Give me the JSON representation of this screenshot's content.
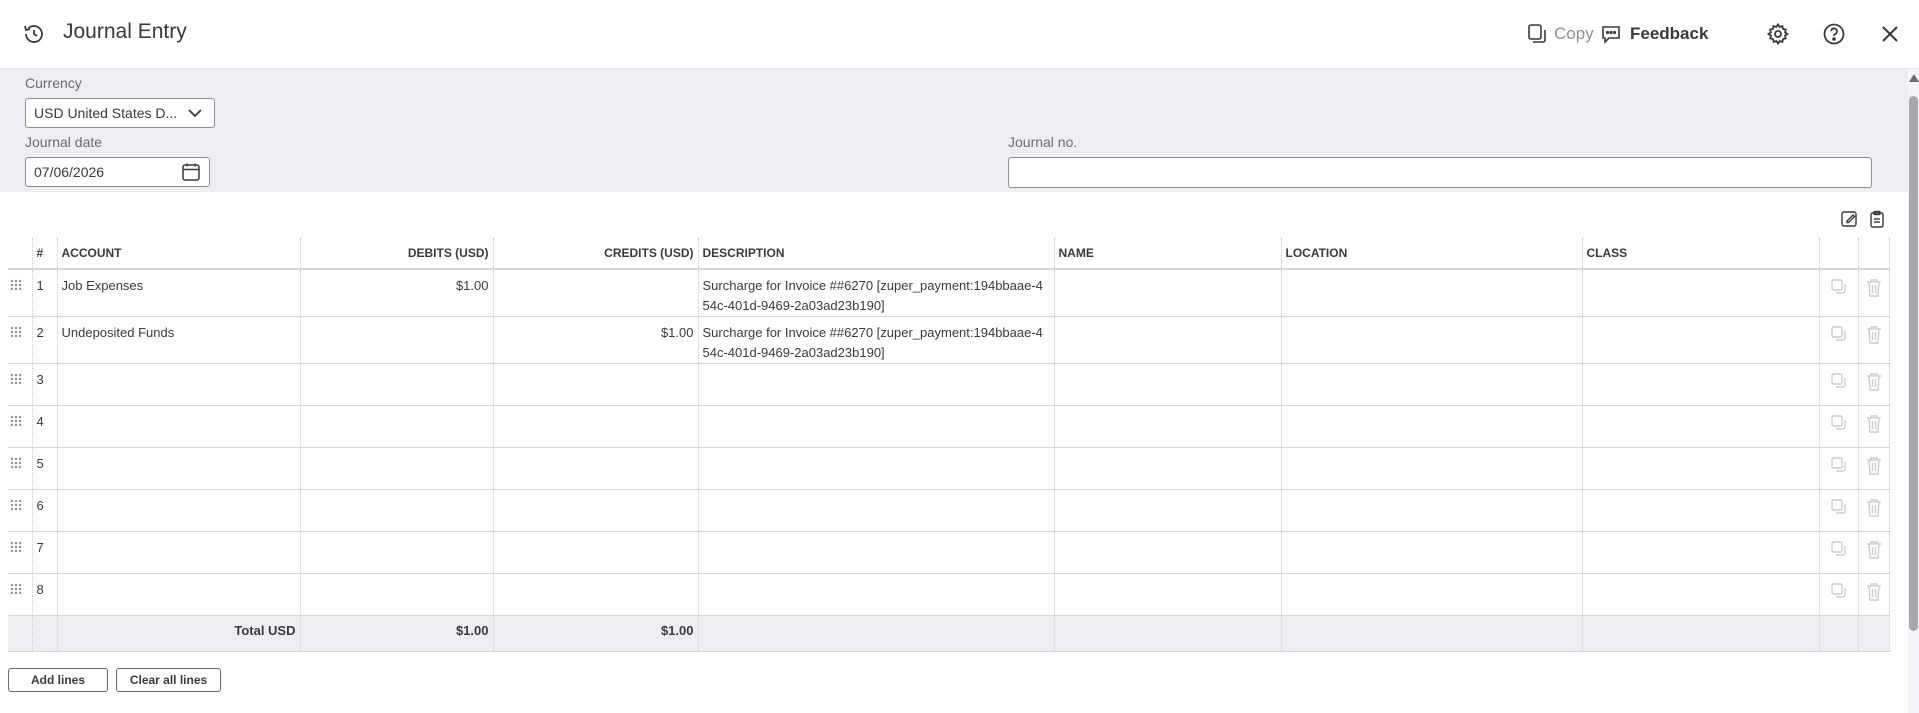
{
  "header": {
    "title": "Journal Entry",
    "copy_label": "Copy",
    "feedback_label": "Feedback"
  },
  "form": {
    "currency_label": "Currency",
    "currency_value": "USD United States D...",
    "date_label": "Journal date",
    "date_value": "07/06/2026",
    "journal_no_label": "Journal no.",
    "journal_no_value": ""
  },
  "table": {
    "headers": {
      "num": "#",
      "account": "ACCOUNT",
      "debits": "DEBITS (USD)",
      "credits": "CREDITS (USD)",
      "description": "DESCRIPTION",
      "name": "NAME",
      "location": "LOCATION",
      "class": "CLASS"
    },
    "rows": [
      {
        "num": "1",
        "account": "Job Expenses",
        "debit": "$1.00",
        "credit": "",
        "description": "Surcharge for Invoice ##6270 [zuper_payment:194bbaae-454c-401d-9469-2a03ad23b190]",
        "name": "",
        "location": "",
        "class": ""
      },
      {
        "num": "2",
        "account": "Undeposited Funds",
        "debit": "",
        "credit": "$1.00",
        "description": "Surcharge for Invoice ##6270 [zuper_payment:194bbaae-454c-401d-9469-2a03ad23b190]",
        "name": "",
        "location": "",
        "class": ""
      },
      {
        "num": "3",
        "account": "",
        "debit": "",
        "credit": "",
        "description": "",
        "name": "",
        "location": "",
        "class": ""
      },
      {
        "num": "4",
        "account": "",
        "debit": "",
        "credit": "",
        "description": "",
        "name": "",
        "location": "",
        "class": ""
      },
      {
        "num": "5",
        "account": "",
        "debit": "",
        "credit": "",
        "description": "",
        "name": "",
        "location": "",
        "class": ""
      },
      {
        "num": "6",
        "account": "",
        "debit": "",
        "credit": "",
        "description": "",
        "name": "",
        "location": "",
        "class": ""
      },
      {
        "num": "7",
        "account": "",
        "debit": "",
        "credit": "",
        "description": "",
        "name": "",
        "location": "",
        "class": ""
      },
      {
        "num": "8",
        "account": "",
        "debit": "",
        "credit": "",
        "description": "",
        "name": "",
        "location": "",
        "class": ""
      }
    ],
    "totals": {
      "label": "Total USD",
      "debit": "$1.00",
      "credit": "$1.00"
    }
  },
  "buttons": {
    "add_lines": "Add lines",
    "clear_all_lines": "Clear all lines"
  },
  "icons": {
    "history": "history-icon",
    "copy": "copy-icon",
    "feedback": "feedback-icon",
    "settings": "gear-icon",
    "help": "help-icon",
    "close": "close-icon",
    "calendar": "calendar-icon",
    "chevron": "chevron-down-icon",
    "drag": "drag-handle-icon",
    "duplicate": "duplicate-icon",
    "delete": "trash-icon"
  }
}
